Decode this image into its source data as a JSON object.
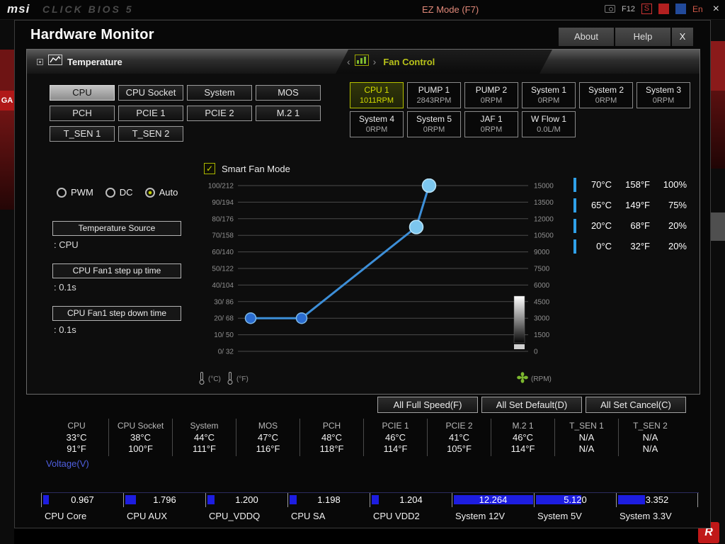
{
  "top_bar": {
    "logo": "msi",
    "product": "CLICK BIOS 5",
    "ez_mode": "EZ Mode (F7)",
    "f12_label": "F12",
    "screenshot_label": "S",
    "language_label": "En",
    "close_label": "×"
  },
  "edges": {
    "left_badge": "GA",
    "bottom_right_badge": "R"
  },
  "dialog": {
    "title": "Hardware Monitor",
    "about": "About",
    "help": "Help",
    "close": "X"
  },
  "temperature_section": {
    "title": "Temperature",
    "sensors": [
      {
        "label": "CPU",
        "selected": true
      },
      {
        "label": "CPU Socket",
        "selected": false
      },
      {
        "label": "System",
        "selected": false
      },
      {
        "label": "MOS",
        "selected": false
      },
      {
        "label": "PCH",
        "selected": false
      },
      {
        "label": "PCIE 1",
        "selected": false
      },
      {
        "label": "PCIE 2",
        "selected": false
      },
      {
        "label": "M.2 1",
        "selected": false
      },
      {
        "label": "T_SEN 1",
        "selected": false
      },
      {
        "label": "T_SEN 2",
        "selected": false
      }
    ]
  },
  "fan_control": {
    "title": "Fan Control",
    "fans": [
      {
        "name": "CPU 1",
        "value": "1011RPM",
        "selected": true
      },
      {
        "name": "PUMP 1",
        "value": "2843RPM",
        "selected": false
      },
      {
        "name": "PUMP 2",
        "value": "0RPM",
        "selected": false
      },
      {
        "name": "System 1",
        "value": "0RPM",
        "selected": false
      },
      {
        "name": "System 2",
        "value": "0RPM",
        "selected": false
      },
      {
        "name": "System 3",
        "value": "0RPM",
        "selected": false
      },
      {
        "name": "System 4",
        "value": "0RPM",
        "selected": false
      },
      {
        "name": "System 5",
        "value": "0RPM",
        "selected": false
      },
      {
        "name": "JAF 1",
        "value": "0RPM",
        "selected": false
      },
      {
        "name": "W Flow 1",
        "value": "0.0L/M",
        "selected": false
      }
    ]
  },
  "fan_settings": {
    "modes": [
      "PWM",
      "DC",
      "Auto"
    ],
    "selected_mode": "Auto",
    "temperature_source_label": "Temperature Source",
    "temperature_source_value": ": CPU",
    "step_up_label": "CPU Fan1 step up time",
    "step_up_value": ": 0.1s",
    "step_down_label": "CPU Fan1 step down time",
    "step_down_value": ": 0.1s",
    "smart_fan_label": "Smart Fan Mode",
    "smart_fan_checked": true
  },
  "chart_data": {
    "type": "line",
    "title": "Smart Fan Mode",
    "x_axis": "temperature_c",
    "x_range": [
      0,
      100
    ],
    "y_axis": "fan_duty_percent",
    "y_range": [
      0,
      100
    ],
    "rpm_range": [
      0,
      15000
    ],
    "grid": true,
    "left_tick_labels": [
      "100/212",
      "90/194",
      "80/176",
      "70/158",
      "60/140",
      "50/122",
      "40/104",
      "30/ 86",
      "20/ 68",
      "10/ 50",
      "0/ 32"
    ],
    "right_tick_labels": [
      "15000",
      "13500",
      "12000",
      "10500",
      "9000",
      "7500",
      "6000",
      "4500",
      "3000",
      "1500",
      "0"
    ],
    "points": [
      {
        "temp_c": 0,
        "temp_f": 32,
        "duty_percent": 20
      },
      {
        "temp_c": 20,
        "temp_f": 68,
        "duty_percent": 20
      },
      {
        "temp_c": 65,
        "temp_f": 149,
        "duty_percent": 75
      },
      {
        "temp_c": 70,
        "temp_f": 158,
        "duty_percent": 100
      }
    ],
    "legend": [
      {
        "c": "70°C",
        "f": "158°F",
        "duty": "100%"
      },
      {
        "c": "65°C",
        "f": "149°F",
        "duty": "75%"
      },
      {
        "c": "20°C",
        "f": "68°F",
        "duty": "20%"
      },
      {
        "c": "0°C",
        "f": "32°F",
        "duty": "20%"
      }
    ],
    "caption_c": "(°C)",
    "caption_f": "(°F)",
    "caption_rpm": "(RPM)"
  },
  "action_buttons": {
    "full_speed": "All Full Speed(F)",
    "set_default": "All Set Default(D)",
    "set_cancel": "All Set Cancel(C)"
  },
  "temperature_readouts": [
    {
      "name": "CPU",
      "c": "33°C",
      "f": "91°F"
    },
    {
      "name": "CPU Socket",
      "c": "38°C",
      "f": "100°F"
    },
    {
      "name": "System",
      "c": "44°C",
      "f": "111°F"
    },
    {
      "name": "MOS",
      "c": "47°C",
      "f": "116°F"
    },
    {
      "name": "PCH",
      "c": "48°C",
      "f": "118°F"
    },
    {
      "name": "PCIE 1",
      "c": "46°C",
      "f": "114°F"
    },
    {
      "name": "PCIE 2",
      "c": "41°C",
      "f": "105°F"
    },
    {
      "name": "M.2 1",
      "c": "46°C",
      "f": "114°F"
    },
    {
      "name": "T_SEN 1",
      "c": "N/A",
      "f": "N/A"
    },
    {
      "name": "T_SEN 2",
      "c": "N/A",
      "f": "N/A"
    }
  ],
  "voltage_section": {
    "title": "Voltage(V)",
    "readings": [
      {
        "name": "CPU Core",
        "value": "0.967",
        "bar_percent": 7
      },
      {
        "name": "CPU AUX",
        "value": "1.796",
        "bar_percent": 13
      },
      {
        "name": "CPU_VDDQ",
        "value": "1.200",
        "bar_percent": 9
      },
      {
        "name": "CPU SA",
        "value": "1.198",
        "bar_percent": 9
      },
      {
        "name": "CPU VDD2",
        "value": "1.204",
        "bar_percent": 9
      },
      {
        "name": "System 12V",
        "value": "12.264",
        "bar_percent": 97
      },
      {
        "name": "System 5V",
        "value": "5.120",
        "bar_percent": 56
      },
      {
        "name": "System 3.3V",
        "value": "3.352",
        "bar_percent": 33
      }
    ]
  },
  "colors": {
    "accent_green": "#c6d300",
    "fan_selected_text": "#d4de00",
    "line_blue": "#3d8fd8",
    "point_dark_blue": "#2a6cd0",
    "point_light_blue": "#7cc6ee",
    "legend_bar_blue": "#2fa0e8",
    "voltage_bar_blue": "#1d1de0",
    "voltage_title_blue": "#4f5fe0",
    "fan_icon_green": "#7cb82f"
  }
}
